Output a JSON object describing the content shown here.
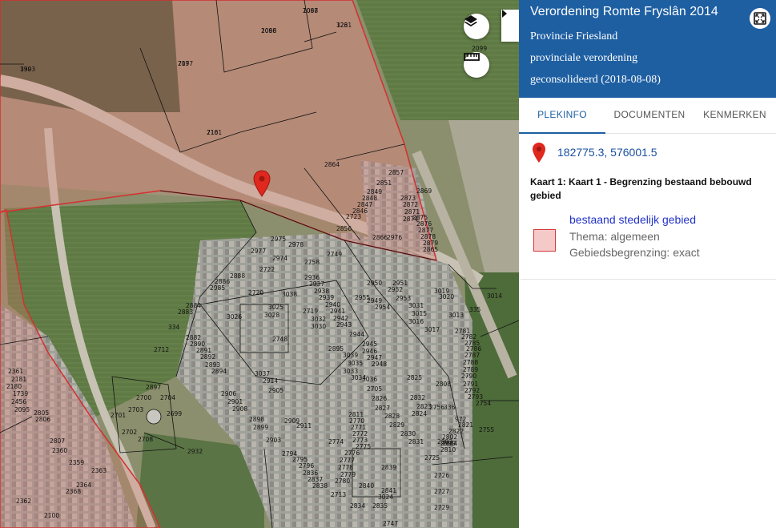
{
  "map": {
    "marker_color": "#e0281f",
    "parcel_labels": [
      "1067",
      "1068",
      "717",
      "716",
      "1993",
      "326",
      "2864",
      "2857",
      "2851",
      "2849",
      "2848",
      "2847",
      "2846",
      "2723",
      "2856",
      "2869",
      "2873",
      "2872",
      "2871",
      "2874",
      "2875",
      "2876",
      "2877",
      "2878",
      "2879",
      "2865",
      "2866",
      "2976",
      "2975",
      "2977",
      "2978",
      "2974",
      "2722",
      "2758",
      "2749",
      "2888",
      "2886",
      "2985",
      "2884",
      "2883",
      "2720",
      "3038",
      "3026",
      "3025",
      "3028",
      "2936",
      "2937",
      "2938",
      "2939",
      "2940",
      "2941",
      "2942",
      "2943",
      "2944",
      "2945",
      "2946",
      "2947",
      "2948",
      "2949",
      "2950",
      "2951",
      "2952",
      "2953",
      "2954",
      "2955",
      "2719",
      "3032",
      "3030",
      "3031",
      "3019",
      "3015",
      "3016",
      "3017",
      "3020",
      "3013",
      "3014",
      "335",
      "334",
      "2748",
      "2712",
      "2882",
      "2890",
      "2891",
      "2892",
      "2893",
      "2894",
      "2895",
      "3039",
      "3035",
      "3033",
      "3034",
      "3036",
      "3037",
      "2914",
      "2905",
      "2906",
      "2901",
      "2908",
      "2898",
      "2899",
      "2903",
      "2909",
      "2911",
      "2932",
      "2897",
      "2700",
      "2704",
      "2701",
      "2703",
      "2699",
      "2702",
      "2708",
      "2705",
      "2826",
      "2827",
      "2828",
      "2829",
      "2830",
      "2831",
      "2832",
      "2823",
      "2824",
      "2825",
      "2808",
      "2809",
      "2810",
      "2811",
      "2770",
      "2771",
      "2772",
      "2773",
      "2774",
      "2775",
      "2776",
      "2777",
      "2778",
      "2779",
      "2780",
      "2781",
      "2782",
      "2785",
      "2786",
      "2787",
      "2788",
      "2789",
      "2790",
      "2791",
      "2792",
      "2793",
      "2794",
      "2795",
      "2796",
      "2836",
      "2837",
      "2838",
      "2839",
      "2840",
      "2841",
      "3024",
      "2713",
      "2834",
      "2835",
      "2725",
      "2726",
      "2727",
      "2729",
      "2747",
      "2754",
      "2755",
      "2756",
      "336",
      "972",
      "2821",
      "2822",
      "2802",
      "2803",
      "2804",
      "2805",
      "2806",
      "2807",
      "2360",
      "2359",
      "2363",
      "2364",
      "2368",
      "2362",
      "2361",
      "2181",
      "2456",
      "2180",
      "1739",
      "2095",
      "2099",
      "2100",
      "2098",
      "2096",
      "2097",
      "2101",
      "330",
      "1231"
    ],
    "layers_icon": "layers-icon",
    "measure_icon": "ruler-icon",
    "collapse_icon": "caret-right-icon",
    "boundary_color": "#d43030",
    "boundary_fill": "rgba(230,120,110,0.28)"
  },
  "panel": {
    "title": "Verordening Romte Fryslân 2014",
    "header_lines": [
      "Provincie Friesland",
      "provinciale verordening",
      "geconsolideerd (2018-08-08)"
    ],
    "header_color": "#1e5fa2",
    "fullscreen_icon": "expand-icon",
    "tabs": [
      {
        "label": "PLEKINFO",
        "active": true
      },
      {
        "label": "DOCUMENTEN",
        "active": false
      },
      {
        "label": "KENMERKEN",
        "active": false
      }
    ],
    "coordinates": "182775.3, 576001.5",
    "pin_icon": "map-pin-icon",
    "kaart_title": "Kaart 1: Kaart 1 - Begrenzing bestaand bebouwd gebied",
    "legend": {
      "name": "bestaand stedelijk gebied",
      "properties": [
        "Thema: algemeen",
        "Gebiedsbegrenzing: exact"
      ],
      "swatch_fill": "#f6c9c9",
      "swatch_border": "#d23b3b"
    }
  }
}
